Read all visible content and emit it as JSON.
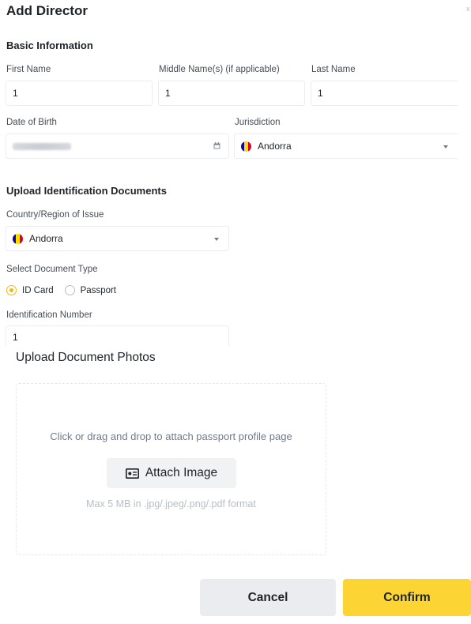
{
  "dialog": {
    "title": "Add Director",
    "close_glyph": "x"
  },
  "basic": {
    "section_title": "Basic Information",
    "first_name": {
      "label": "First Name",
      "value": "1"
    },
    "middle_name": {
      "label": "Middle Name(s) (if applicable)",
      "value": "1"
    },
    "last_name": {
      "label": "Last Name",
      "value": "1"
    },
    "dob": {
      "label": "Date of Birth",
      "value_hidden": true,
      "icon": "calendar-icon"
    },
    "jurisdiction": {
      "label": "Jurisdiction",
      "value": "Andorra",
      "flag": "andorra-flag-icon"
    }
  },
  "identification": {
    "section_title": "Upload Identification Documents",
    "country": {
      "label": "Country/Region of Issue",
      "value": "Andorra",
      "flag": "andorra-flag-icon"
    },
    "doc_type": {
      "label": "Select Document Type",
      "options": [
        {
          "label": "ID Card",
          "checked": true
        },
        {
          "label": "Passport",
          "checked": false
        }
      ]
    },
    "id_number": {
      "label": "Identification Number",
      "value": "1"
    }
  },
  "upload": {
    "title": "Upload Document Photos",
    "hint": "Click or drag and drop to attach passport profile page",
    "attach_label": "Attach Image",
    "format_hint": "Max 5 MB in .jpg/.jpeg/.png/.pdf format"
  },
  "actions": {
    "cancel_label": "Cancel",
    "confirm_label": "Confirm"
  },
  "colors": {
    "accent_yellow": "#fcd535",
    "radio_selected": "#f0b90b",
    "flag_blue": "#10069f",
    "flag_yellow": "#fedd00",
    "flag_red": "#d50032"
  }
}
